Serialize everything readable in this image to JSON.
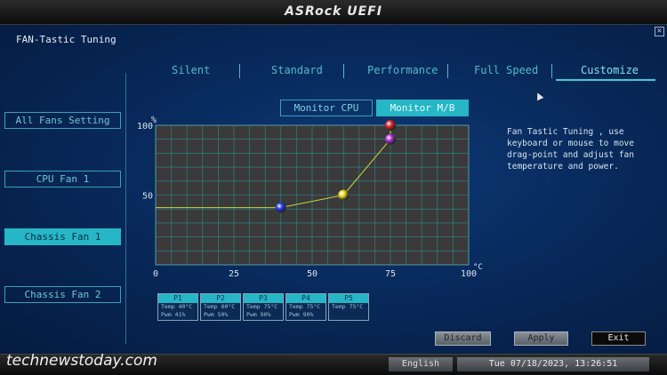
{
  "app": {
    "brand": "ASRock UEFI",
    "page_title": "FAN-Tastic Tuning",
    "close_glyph": "✕"
  },
  "tabs": [
    {
      "label": "Silent"
    },
    {
      "label": "Standard"
    },
    {
      "label": "Performance"
    },
    {
      "label": "Full Speed"
    },
    {
      "label": "Customize",
      "active": true
    }
  ],
  "sidebar": {
    "items": [
      {
        "label": "All Fans Setting"
      },
      {
        "label": "CPU Fan 1"
      },
      {
        "label": "Chassis Fan 1",
        "active": true
      },
      {
        "label": "Chassis Fan 2"
      }
    ]
  },
  "monitor": {
    "cpu_label": "Monitor CPU",
    "mb_label": "Monitor M/B",
    "selected": "Monitor M/B"
  },
  "help_text": "Fan Tastic Tuning , use keyboard or mouse to move drag-point and adjust fan temperature and power.",
  "chart_data": {
    "type": "line",
    "x_unit": "°C",
    "y_unit": "%",
    "xlim": [
      0,
      100
    ],
    "ylim": [
      0,
      100
    ],
    "x_ticks": [
      0,
      25,
      50,
      75,
      100
    ],
    "y_ticks": [
      50,
      100
    ],
    "grid": true,
    "series": [
      {
        "points": [
          [
            0,
            41
          ],
          [
            40,
            41
          ],
          [
            60,
            50
          ],
          [
            75,
            90
          ],
          [
            75,
            100
          ]
        ]
      }
    ],
    "markers": [
      {
        "label": "P1",
        "x": 40,
        "y": 41,
        "color": "#2233ee"
      },
      {
        "label": "P2",
        "x": 60,
        "y": 50,
        "color": "#e6d21a"
      },
      {
        "label": "P4",
        "x": 75,
        "y": 90,
        "color": "#b030d8"
      },
      {
        "label": "P5",
        "x": 75,
        "y": 100,
        "color": "#e02222"
      }
    ]
  },
  "points": [
    {
      "name": "P1",
      "temp": "Temp 40°C",
      "pwm": "Pwm  41%"
    },
    {
      "name": "P2",
      "temp": "Temp 60°C",
      "pwm": "Pwm  50%"
    },
    {
      "name": "P3",
      "temp": "Temp 75°C",
      "pwm": "Pwm  90%"
    },
    {
      "name": "P4",
      "temp": "Temp 75°C",
      "pwm": "Pwm  90%"
    },
    {
      "name": "P5",
      "temp": "Temp 75°C",
      "pwm": ""
    }
  ],
  "actions": {
    "discard": "Discard",
    "apply": "Apply",
    "exit": "Exit"
  },
  "footer": {
    "watermark": "technewstoday.com",
    "language": "English",
    "datetime": "Tue 07/18/2023, 13:26:51"
  },
  "colors": {
    "accent": "#26b6c6",
    "background": "#082a5c",
    "grid": "#2c8c90",
    "curve": "#c8d83a"
  }
}
